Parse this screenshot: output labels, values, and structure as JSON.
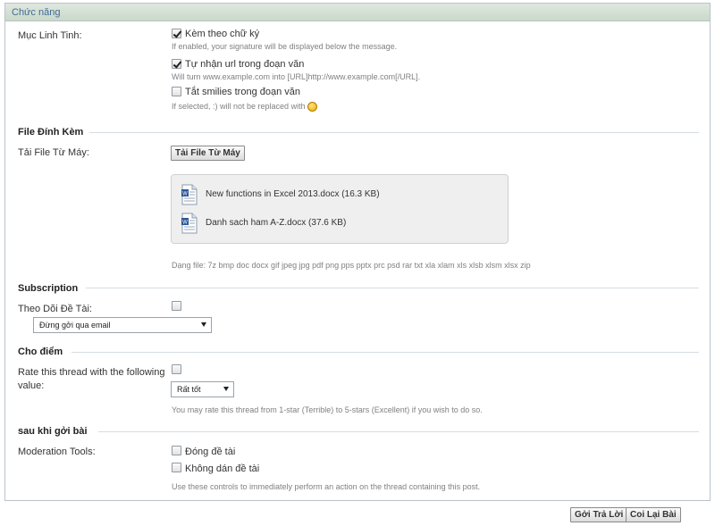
{
  "panel_title": "Chức năng",
  "misc": {
    "label": "Mục Linh Tinh:",
    "signature": {
      "label": "Kèm theo chữ ký",
      "checked": true,
      "hint": "If enabled, your signature will be displayed below the message."
    },
    "parse_url": {
      "label": "Tự nhận url trong đoạn văn",
      "checked": true,
      "hint": "Will turn www.example.com into [URL]http://www.example.com[/URL]."
    },
    "disable_smilies": {
      "label": "Tắt smilies trong đoạn văn",
      "checked": false,
      "hint": "If selected, :) will not be replaced with"
    }
  },
  "attachments": {
    "section_title": "File Đính Kèm",
    "upload_label": "Tải File Từ Máy:",
    "upload_button": "Tải File Từ Máy",
    "files": [
      {
        "name": "New functions in Excel 2013.docx (16.3 KB)"
      },
      {
        "name": "Danh sach ham A-Z.docx (37.6 KB)"
      }
    ],
    "types_hint": "Dạng file: 7z bmp doc docx gif jpeg jpg pdf png pps pptx prc psd rar txt xla xlam xls xlsb xlsm xlsx zip"
  },
  "subscription": {
    "section_title": "Subscription",
    "label": "Theo Dõi Đề Tài:",
    "checked": false,
    "selected": "Đừng gởi qua email"
  },
  "rating": {
    "section_title": "Cho điểm",
    "label_line1": "Rate this thread with the following",
    "label_line2": "value:",
    "checked": false,
    "selected": "Rất tốt",
    "hint": "You may rate this thread from 1-star (Terrible) to 5-stars (Excellent) if you wish to do so."
  },
  "moderation": {
    "section_title": "sau khi gởi bài",
    "label": "Moderation Tools:",
    "close_thread": {
      "label": "Đóng đề tài",
      "checked": false
    },
    "unstick_thread": {
      "label": "Không dán đề tài",
      "checked": false
    },
    "hint": "Use these controls to immediately perform an action on the thread containing this post."
  },
  "actions": {
    "submit": "Gởi Trả Lời",
    "preview": "Coi Lại Bài"
  }
}
